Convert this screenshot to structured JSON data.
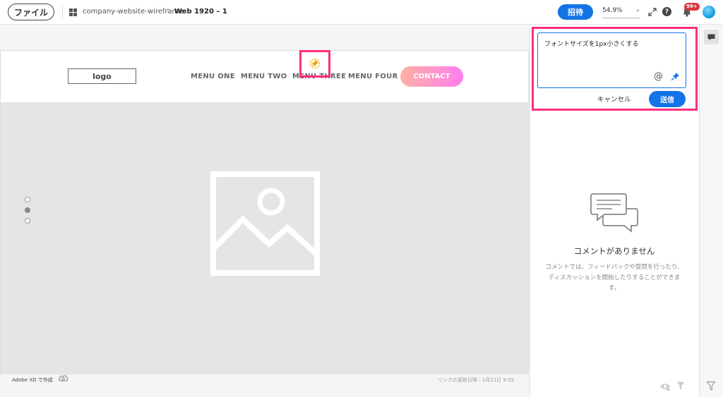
{
  "header": {
    "file_button": "ファイル",
    "project_name": "company-website-wireframe",
    "breadcrumb_separator": ">",
    "page_name": "Web 1920 – 1",
    "invite_button": "招待",
    "zoom_level": "54.9%",
    "help_glyph": "?",
    "notification_badge": "99+"
  },
  "artboard": {
    "logo_text": "logo",
    "menu_items": [
      "MENU ONE",
      "MENU TWO",
      "MENU THREE",
      "MENU FOUR"
    ],
    "contact_button": "CONTACT",
    "carousel_active_index": 1
  },
  "footer": {
    "made_with": "Adobe XD で作成",
    "last_updated": "リンクの更新日時 : 1月21日 9:55"
  },
  "comment_panel": {
    "draft_text": "フォントサイズを1px小さくする",
    "mention_glyph": "@",
    "cancel_button": "キャンセル",
    "send_button": "送信",
    "empty_title": "コメントがありません",
    "empty_description": "コメントでは、フィードバックや質問を行ったり、ディスカッションを開始したりすることができます。"
  },
  "colors": {
    "accent_blue": "#1473e6",
    "highlight_pink": "#ff2e7e",
    "contact_gradient_start": "#ffb0a3",
    "contact_gradient_end": "#ff7eef",
    "badge_red": "#d7373f"
  },
  "icons": [
    "grid-icon",
    "expand-icon",
    "help-icon",
    "bell-icon",
    "avatar",
    "pin-icon",
    "mention-icon",
    "chat-bubbles-icon",
    "hide-resolved-icon",
    "filter-icon",
    "comment-icon",
    "creative-cloud-icon",
    "image-placeholder-icon"
  ]
}
